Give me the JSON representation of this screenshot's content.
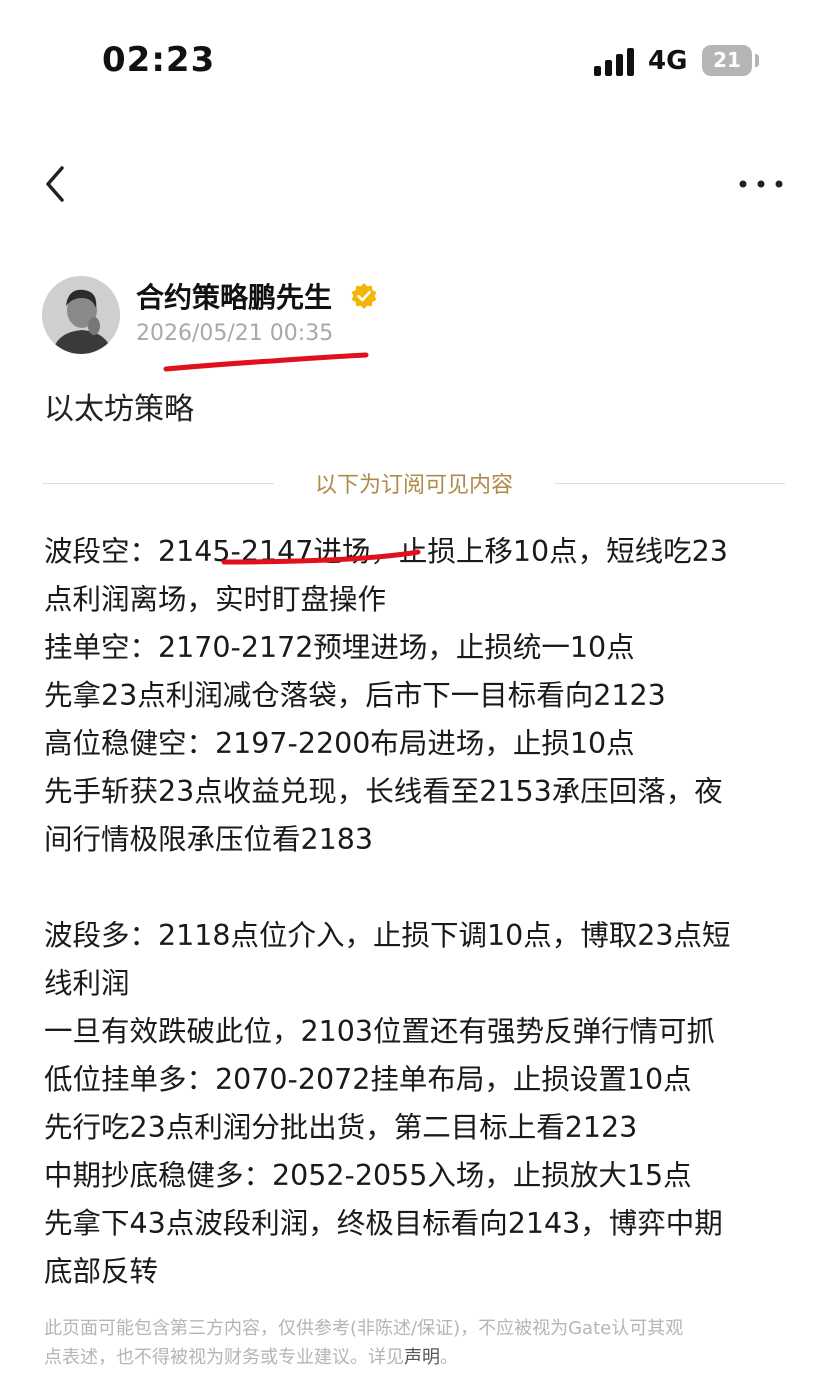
{
  "status": {
    "time": "02:23",
    "network": "4G",
    "battery": "21"
  },
  "nav": {
    "back_icon": "chevron-left-icon",
    "more_icon": "more-dots-icon"
  },
  "author": {
    "name": "合约策略鹏先生",
    "verified_icon": "verified-badge-icon",
    "timestamp": "2026/05/21 00:35"
  },
  "post": {
    "title": "以太坊策略",
    "subscription_divider": "以下为订阅可见内容",
    "lines": [
      "波段空：2145-2147进场，止损上移10点，短线吃23",
      "点利润离场，实时盯盘操作",
      "挂单空：2170-2172预埋进场，止损统一10点",
      "先拿23点利润减仓落袋，后市下一目标看向2123",
      "高位稳健空：2197-2200布局进场，止损10点",
      "先手斩获23点收益兑现，长线看至2153承压回落，夜",
      "间行情极限承压位看2183",
      "",
      "波段多：2118点位介入，止损下调10点，博取23点短",
      "线利润",
      "一旦有效跌破此位，2103位置还有强势反弹行情可抓",
      "低位挂单多：2070-2072挂单布局，止损设置10点",
      "先行吃23点利润分批出货，第二目标上看2123",
      "中期抄底稳健多：2052-2055入场，止损放大15点",
      "先拿下43点波段利润，终极目标看向2143，博弈中期",
      "底部反转"
    ]
  },
  "disclaimer": {
    "line1": "此页面可能包含第三方内容，仅供参考(非陈述/保证)，不应被视为Gate认可其观",
    "line2_prefix": "点表述，也不得被视为财务或专业建议。详见",
    "link": "声明",
    "line2_suffix": "。"
  },
  "colors": {
    "accent_gold": "#b08a48",
    "verified": "#f2b705",
    "annotation_red": "#e0101c",
    "muted_text": "#a8a8a8"
  }
}
